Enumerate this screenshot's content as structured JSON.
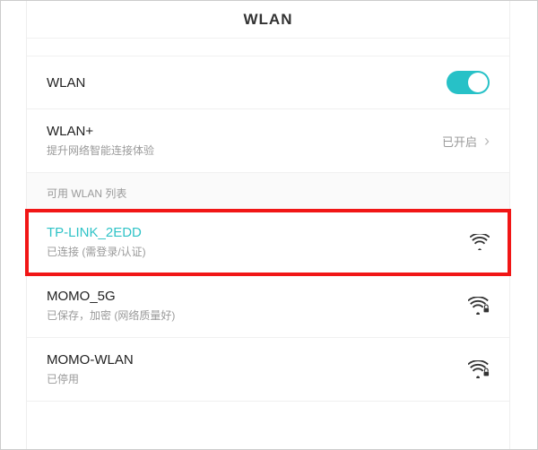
{
  "header": {
    "title": "WLAN"
  },
  "wlan_toggle": {
    "label": "WLAN",
    "on": true
  },
  "wlan_plus": {
    "title": "WLAN+",
    "subtitle": "提升网络智能连接体验",
    "status": "已开启"
  },
  "section_header": "可用 WLAN 列表",
  "networks": [
    {
      "ssid": "TP-LINK_2EDD",
      "status": "已连接 (需登录/认证)",
      "connected": true
    },
    {
      "ssid": "MOMO_5G",
      "status": "已保存，加密 (网络质量好)",
      "connected": false
    },
    {
      "ssid": "MOMO-WLAN",
      "status": "已停用",
      "connected": false
    }
  ],
  "colors": {
    "accent": "#27c1c7",
    "highlight": "#f11616"
  }
}
